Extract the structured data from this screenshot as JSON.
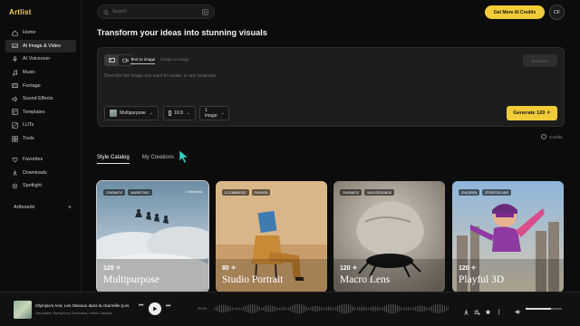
{
  "app": {
    "logo": "Artlist"
  },
  "sidebar": {
    "items": [
      {
        "label": "Home",
        "icon": "home-icon"
      },
      {
        "label": "AI Image & Video",
        "icon": "image-icon",
        "active": true
      },
      {
        "label": "AI Voiceover",
        "icon": "mic-icon"
      },
      {
        "label": "Music",
        "icon": "music-icon"
      },
      {
        "label": "Footage",
        "icon": "film-icon"
      },
      {
        "label": "Sound Effects",
        "icon": "sound-icon"
      },
      {
        "label": "Templates",
        "icon": "template-icon"
      },
      {
        "label": "LUTs",
        "icon": "lut-icon"
      },
      {
        "label": "Tools",
        "icon": "tools-icon"
      }
    ],
    "secondary": [
      {
        "label": "Favorites",
        "icon": "heart-icon"
      },
      {
        "label": "Downloads",
        "icon": "download-icon"
      },
      {
        "label": "Spotlight",
        "icon": "spotlight-icon"
      }
    ],
    "artboards_label": "Artboards",
    "artboards_add": "+"
  },
  "header": {
    "search_placeholder": "Search",
    "credits_button": "Get More AI Credits",
    "avatar_initials": "CF"
  },
  "main": {
    "title": "Transform your ideas into stunning visuals",
    "prompt": {
      "tab_text_to_image": "Text to image",
      "tab_image_to_image": "Image to image",
      "enhance_label": "Enhance",
      "placeholder": "Describe the image you want to create, in any language",
      "style_option": "Multipurpose",
      "ratio_option": "16:9",
      "count_option": "1 image",
      "generate_label": "Generate 120 ✧"
    },
    "credits_note": "Credits",
    "catalog_tabs": [
      "Style Catalog",
      "My Creations"
    ],
    "cards": [
      {
        "tags": [
          "CINEMATIC",
          "MARKETING"
        ],
        "selected": "✓ Selected",
        "cost": "120 ✧",
        "name": "Multipurpose"
      },
      {
        "tags": [
          "E-COMMERCE",
          "FASHION"
        ],
        "cost": "80 ✧",
        "name": "Studio Portrait"
      },
      {
        "tags": [
          "CINEMATIC",
          "BACKGROUNDS"
        ],
        "cost": "120 ✧",
        "name": "Macro Lens"
      },
      {
        "tags": [
          "CHILDREN",
          "STORYTELLING"
        ],
        "cost": "120 ✧",
        "name": "Playful 3D"
      }
    ]
  },
  "player": {
    "title": "Olympia's Aria: Les Oiseaux dans la charmille (Les",
    "artist": "Jerusalem Symphony Orchestra, Artlist Classics",
    "time": "00:00",
    "volume": 0.7
  },
  "colors": {
    "accent": "#f2cc38",
    "background": "#0c0c0c",
    "panel": "#1d1d1d"
  }
}
